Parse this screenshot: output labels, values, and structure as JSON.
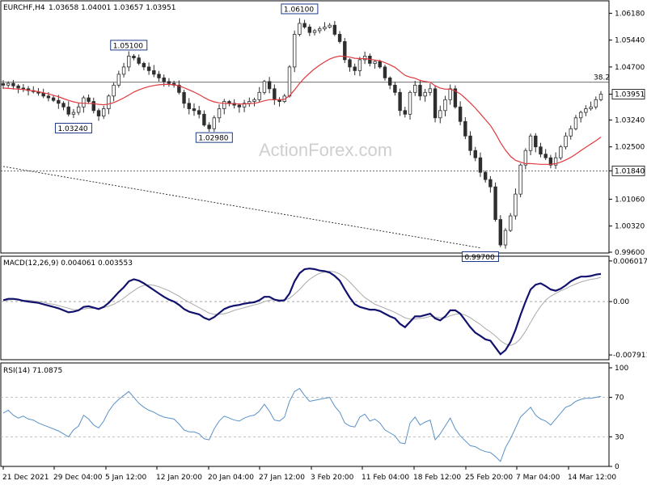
{
  "chart_data": [
    {
      "type": "candlestick",
      "title": "EURCHF,H4",
      "ohlc_text": "1.03658 1.04001 1.03657 1.03951",
      "y_ticks": [
        "1.06180",
        "1.05440",
        "1.04700",
        "1.03951",
        "1.03240",
        "1.02500",
        "1.01840",
        "1.01060",
        "1.00320",
        "0.99600"
      ],
      "ylim": [
        0.996,
        1.065
      ],
      "current_price": "1.03951",
      "horizontal_levels": [
        {
          "label": "38.2",
          "value": 1.0428,
          "style": "solid"
        },
        {
          "label": "1.01840",
          "value": 1.0184,
          "style": "dotted"
        }
      ],
      "annotations": [
        {
          "text": "1.06100",
          "x": 59,
          "value": 1.061
        },
        {
          "text": "1.05100",
          "x": 25,
          "value": 1.051
        },
        {
          "text": "1.03240",
          "x": 14,
          "value": 1.0324
        },
        {
          "text": "1.02980",
          "x": 42,
          "value": 1.0298
        },
        {
          "text": "0.99700",
          "x": 95,
          "value": 0.997
        }
      ],
      "trendline": [
        [
          0,
          1.0196
        ],
        [
          95,
          0.9972
        ]
      ],
      "close_series": [
        1.042,
        1.0425,
        1.0418,
        1.0412,
        1.041,
        1.0405,
        1.0402,
        1.0398,
        1.039,
        1.0385,
        1.0378,
        1.037,
        1.036,
        1.034,
        1.0345,
        1.036,
        1.0385,
        1.0375,
        1.035,
        1.0335,
        1.0355,
        1.039,
        1.042,
        1.045,
        1.047,
        1.05,
        1.0495,
        1.048,
        1.047,
        1.046,
        1.045,
        1.044,
        1.043,
        1.0425,
        1.042,
        1.04,
        1.037,
        1.0355,
        1.035,
        1.034,
        1.031,
        1.03,
        1.033,
        1.0355,
        1.0375,
        1.037,
        1.0365,
        1.036,
        1.037,
        1.0375,
        1.038,
        1.04,
        1.043,
        1.041,
        1.038,
        1.0375,
        1.039,
        1.047,
        1.056,
        1.059,
        1.058,
        1.0565,
        1.057,
        1.0575,
        1.058,
        1.0585,
        1.056,
        1.054,
        1.049,
        1.047,
        1.046,
        1.049,
        1.05,
        1.048,
        1.0485,
        1.047,
        1.044,
        1.042,
        1.04,
        1.035,
        1.034,
        1.04,
        1.042,
        1.039,
        1.04,
        1.041,
        1.033,
        1.035,
        1.038,
        1.041,
        1.036,
        1.032,
        1.028,
        1.024,
        1.022,
        1.018,
        1.016,
        1.014,
        1.005,
        0.998,
        1.002,
        1.006,
        1.012,
        1.02,
        1.024,
        1.028,
        1.025,
        1.023,
        1.022,
        1.02,
        1.022,
        1.025,
        1.028,
        1.03,
        1.033,
        1.0345,
        1.0355,
        1.036,
        1.038,
        1.0395
      ],
      "moving_average": [
        1.0412,
        1.0411,
        1.041,
        1.0409,
        1.0408,
        1.0406,
        1.0404,
        1.0402,
        1.0399,
        1.0396,
        1.0392,
        1.0388,
        1.0383,
        1.0378,
        1.0374,
        1.0371,
        1.037,
        1.037,
        1.0369,
        1.0367,
        1.0366,
        1.0368,
        1.0372,
        1.0378,
        1.0385,
        1.0393,
        1.0401,
        1.0407,
        1.0412,
        1.0416,
        1.0419,
        1.0421,
        1.0422,
        1.0422,
        1.0421,
        1.0418,
        1.0413,
        1.0407,
        1.0401,
        1.0394,
        1.0386,
        1.0379,
        1.0374,
        1.0371,
        1.037,
        1.0369,
        1.0369,
        1.0368,
        1.0368,
        1.0369,
        1.037,
        1.0373,
        1.0377,
        1.038,
        1.038,
        1.038,
        1.0381,
        1.0391,
        1.0407,
        1.0425,
        1.044,
        1.0453,
        1.0465,
        1.0475,
        1.0484,
        1.0492,
        1.0497,
        1.05,
        1.0499,
        1.0497,
        1.0494,
        1.0493,
        1.0493,
        1.0491,
        1.0489,
        1.0487,
        1.0482,
        1.0476,
        1.0469,
        1.0458,
        1.0447,
        1.0442,
        1.0439,
        1.0433,
        1.043,
        1.0428,
        1.0418,
        1.0412,
        1.0409,
        1.0409,
        1.0404,
        1.0396,
        1.0384,
        1.0371,
        1.0357,
        1.0341,
        1.0325,
        1.0309,
        1.0287,
        1.0262,
        1.0241,
        1.0224,
        1.0213,
        1.0208,
        1.0204,
        1.0204,
        1.0203,
        1.0202,
        1.0202,
        1.0202,
        1.0204,
        1.0208,
        1.0214,
        1.0221,
        1.023,
        1.024,
        1.0249,
        1.0258,
        1.0267,
        1.0277
      ]
    },
    {
      "type": "line",
      "title": "MACD(12,26,9) 0.004061 0.003553",
      "y_ticks": [
        "0.006017",
        "0.00",
        "-0.007911"
      ],
      "ylim": [
        -0.0085,
        0.0066
      ],
      "series": [
        {
          "values": [
            0.0002,
            0.0004,
            0.0004,
            0.0003,
            0.0001,
            0.0,
            -0.0001,
            -0.0002,
            -0.0004,
            -0.0006,
            -0.0008,
            -0.001,
            -0.0013,
            -0.0016,
            -0.0015,
            -0.0013,
            -0.0008,
            -0.0007,
            -0.0009,
            -0.0011,
            -0.0008,
            -0.0002,
            0.0006,
            0.0014,
            0.0021,
            0.003,
            0.0033,
            0.0031,
            0.0027,
            0.0022,
            0.0017,
            0.0012,
            0.0007,
            0.0003,
            0.0,
            -0.0005,
            -0.0011,
            -0.0015,
            -0.0017,
            -0.0019,
            -0.0024,
            -0.0027,
            -0.0023,
            -0.0017,
            -0.0011,
            -0.0008,
            -0.0006,
            -0.0005,
            -0.0003,
            -0.0002,
            -0.0001,
            0.0002,
            0.0007,
            0.0007,
            0.0003,
            0.0001,
            0.0002,
            0.0012,
            0.003,
            0.0042,
            0.0048,
            0.0049,
            0.0048,
            0.0046,
            0.0045,
            0.0043,
            0.0038,
            0.0031,
            0.0018,
            0.0006,
            -0.0004,
            -0.0008,
            -0.001,
            -0.0012,
            -0.0012,
            -0.0014,
            -0.0018,
            -0.0022,
            -0.0025,
            -0.0033,
            -0.0038,
            -0.003,
            -0.0022,
            -0.0022,
            -0.002,
            -0.0018,
            -0.0025,
            -0.0028,
            -0.0022,
            -0.0013,
            -0.0013,
            -0.0018,
            -0.0028,
            -0.0038,
            -0.0046,
            -0.0051,
            -0.0056,
            -0.0058,
            -0.0068,
            -0.0078,
            -0.0072,
            -0.006,
            -0.0042,
            -0.002,
            0.0,
            0.0018,
            0.0025,
            0.0027,
            0.0023,
            0.0018,
            0.0016,
            0.0019,
            0.0024,
            0.003,
            0.0034,
            0.0037,
            0.0037,
            0.0038,
            0.004,
            0.0041
          ]
        },
        {
          "values": [
            0.0001,
            0.0002,
            0.0003,
            0.0003,
            0.0002,
            0.0002,
            0.0001,
            0.0,
            -0.0001,
            -0.0003,
            -0.0004,
            -0.0006,
            -0.0008,
            -0.001,
            -0.0012,
            -0.0012,
            -0.0011,
            -0.001,
            -0.001,
            -0.001,
            -0.0009,
            -0.0007,
            -0.0004,
            0.0,
            0.0005,
            0.0011,
            0.0016,
            0.0021,
            0.0024,
            0.0025,
            0.0024,
            0.0022,
            0.0019,
            0.0016,
            0.0012,
            0.0008,
            0.0003,
            -0.0001,
            -0.0005,
            -0.0009,
            -0.0013,
            -0.0017,
            -0.0019,
            -0.0019,
            -0.0018,
            -0.0016,
            -0.0013,
            -0.0011,
            -0.0009,
            -0.0007,
            -0.0005,
            -0.0003,
            0.0,
            0.0002,
            0.0003,
            0.0003,
            0.0002,
            0.0005,
            0.0011,
            0.0018,
            0.0026,
            0.0033,
            0.0038,
            0.0042,
            0.0044,
            0.0045,
            0.0044,
            0.0041,
            0.0036,
            0.0029,
            0.0021,
            0.0013,
            0.0006,
            0.0001,
            -0.0004,
            -0.0007,
            -0.001,
            -0.0013,
            -0.0016,
            -0.002,
            -0.0024,
            -0.0026,
            -0.0026,
            -0.0025,
            -0.0024,
            -0.0022,
            -0.0023,
            -0.0024,
            -0.0024,
            -0.0021,
            -0.0019,
            -0.0018,
            -0.002,
            -0.0024,
            -0.0029,
            -0.0034,
            -0.004,
            -0.0045,
            -0.0051,
            -0.0058,
            -0.0063,
            -0.0065,
            -0.0062,
            -0.0055,
            -0.0044,
            -0.0031,
            -0.0018,
            -0.0007,
            0.0002,
            0.0008,
            0.0012,
            0.0016,
            0.0019,
            0.0023,
            0.0026,
            0.0029,
            0.0031,
            0.0033,
            0.0034,
            0.0036
          ]
        }
      ]
    },
    {
      "type": "line",
      "title": "RSI(14) 71.0875",
      "y_ticks": [
        "100",
        "70",
        "30",
        "0"
      ],
      "ylim": [
        0,
        100
      ],
      "reference_lines": [
        70,
        30
      ],
      "series": [
        {
          "values": [
            54,
            57,
            52,
            49,
            51,
            48,
            47,
            44,
            42,
            40,
            38,
            36,
            33,
            30,
            37,
            41,
            52,
            48,
            42,
            39,
            46,
            56,
            63,
            68,
            72,
            76,
            70,
            64,
            60,
            57,
            55,
            52,
            50,
            49,
            48,
            43,
            37,
            35,
            35,
            33,
            28,
            27,
            38,
            46,
            51,
            49,
            47,
            46,
            49,
            51,
            52,
            56,
            63,
            56,
            47,
            46,
            50,
            66,
            76,
            79,
            72,
            66,
            67,
            68,
            69,
            70,
            61,
            55,
            44,
            41,
            40,
            50,
            53,
            46,
            48,
            44,
            37,
            34,
            31,
            24,
            23,
            44,
            50,
            42,
            45,
            47,
            27,
            33,
            41,
            49,
            38,
            31,
            26,
            21,
            20,
            17,
            15,
            14,
            10,
            5,
            19,
            28,
            39,
            50,
            55,
            60,
            52,
            48,
            46,
            42,
            48,
            54,
            60,
            62,
            66,
            68,
            69,
            69,
            70,
            71
          ]
        }
      ]
    }
  ],
  "x_ticks": [
    "21 Dec 2021",
    "29 Dec 04:00",
    "5 Jan 12:00",
    "12 Jan 20:00",
    "20 Jan 04:00",
    "27 Jan 12:00",
    "3 Feb 20:00",
    "11 Feb 04:00",
    "18 Feb 12:00",
    "25 Feb 20:00",
    "7 Mar 04:00",
    "14 Mar 12:00"
  ],
  "watermark": "ActionForex.com",
  "colors": {
    "candle": "#2e2e2e",
    "moving_average": "#e0393e",
    "macd": "#12126e",
    "signal": "#aaaaaa",
    "rsi": "#5a91c8",
    "grid": "#9a9a9a"
  }
}
